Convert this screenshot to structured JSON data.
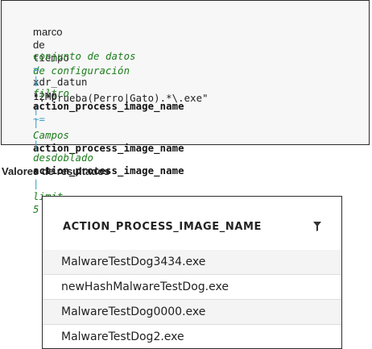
{
  "code": {
    "line1": {
      "a": "marco",
      "b": "de",
      "c": "tiempo",
      "d": "de configuración",
      "e": "=",
      "f": "12MO",
      "g": "|"
    },
    "line2": {
      "a": "conjunto de datos",
      "b": "=",
      "c": "xdr_datun"
    },
    "line3": {
      "pipe": "|",
      "kw": "filtro",
      "field": "action_process_image_name",
      "op": "~="
    },
    "line4": {
      "value": "\".*Prueba(Perro|Gato).*\\.exe\""
    },
    "line5": {
      "pipe": "|",
      "kw": "Campos",
      "field": "action_process_image_name"
    },
    "line6": {
      "pipe": "|",
      "kw": "desdoblado",
      "field": "action_process_image_name",
      "pipe2": "|",
      "kw2": "limit",
      "num": "5"
    }
  },
  "results": {
    "heading": "Valores de resultados",
    "column": "ACTION_PROCESS_IMAGE_NAME",
    "rows": [
      "MalwareTestDog3434.exe",
      "newHashMalwareTestDog.exe",
      "MalwareTestDog0000.exe",
      "MalwareTestDog2.exe"
    ]
  },
  "icons": {
    "filter": "filter-icon"
  }
}
